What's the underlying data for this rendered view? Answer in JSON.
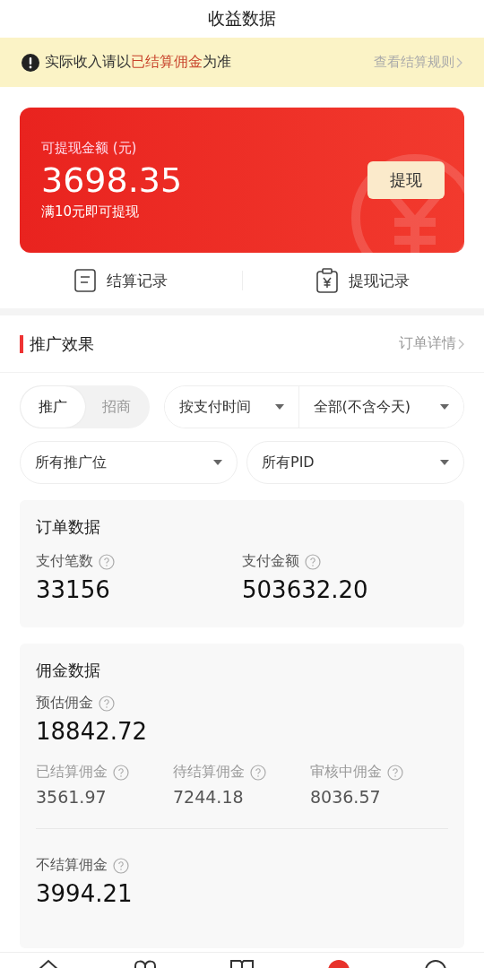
{
  "header": {
    "title": "收益数据"
  },
  "notice": {
    "before": "实际收入请以",
    "highlight": "已结算佣金",
    "after": "为准",
    "link": "查看结算规则"
  },
  "balance": {
    "label": "可提现金额 (元)",
    "amount": "3698.35",
    "hint": "满10元即可提现",
    "button": "提现"
  },
  "records": [
    {
      "kind": "settle",
      "label": "结算记录"
    },
    {
      "kind": "withdraw",
      "label": "提现记录"
    }
  ],
  "section": {
    "title": "推广效果",
    "link": "订单详情"
  },
  "segments": [
    {
      "label": "推广",
      "selected": true
    },
    {
      "label": "招商",
      "selected": false
    }
  ],
  "filters": [
    {
      "label": "按支付时间"
    },
    {
      "label": "全部(不含今天)"
    },
    {
      "label": "所有推广位"
    },
    {
      "label": "所有PID"
    }
  ],
  "order_data": {
    "title": "订单数据",
    "stats": [
      {
        "label": "支付笔数",
        "value": "33156"
      },
      {
        "label": "支付金额",
        "value": "503632.20"
      }
    ]
  },
  "commission_data": {
    "title": "佣金数据",
    "estimate": {
      "label": "预估佣金",
      "value": "18842.72"
    },
    "details": [
      {
        "label": "已结算佣金",
        "value": "3561.97"
      },
      {
        "label": "待结算佣金",
        "value": "7244.18"
      },
      {
        "label": "审核中佣金",
        "value": "8036.57"
      }
    ],
    "unsettled": {
      "label": "不结算佣金",
      "value": "3994.21"
    }
  },
  "bottom_nav": [
    {
      "kind": "home"
    },
    {
      "kind": "heart"
    },
    {
      "kind": "book"
    },
    {
      "kind": "dot"
    },
    {
      "kind": "circle"
    }
  ]
}
